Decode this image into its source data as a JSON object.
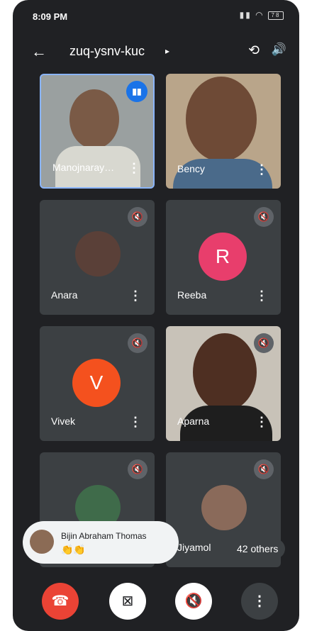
{
  "status_bar": {
    "time": "8:09 PM",
    "battery": "78"
  },
  "header": {
    "meeting_code": "zuq-ysnv-kuc",
    "caret": "▸",
    "back_icon": "←",
    "camera_switch_icon": "⟲",
    "speaker_icon": "🔊"
  },
  "tiles": [
    {
      "name": "Manojnaray…",
      "type": "video",
      "speaking": true
    },
    {
      "name": "Bency",
      "type": "video"
    },
    {
      "name": "Anara",
      "type": "photo",
      "muted": true
    },
    {
      "name": "Reeba",
      "type": "letter",
      "letter": "R",
      "color": "#e83e6c",
      "muted": true
    },
    {
      "name": "Vivek",
      "type": "letter",
      "letter": "V",
      "color": "#f4511e",
      "muted": true
    },
    {
      "name": "Aparna",
      "type": "video",
      "muted": true
    },
    {
      "name": "",
      "type": "photo",
      "muted": true
    },
    {
      "name": "Jiyamol",
      "type": "photo",
      "muted": true
    }
  ],
  "menu_glyph": "⋮",
  "mute_glyph": "🔇",
  "speaking_glyph": "▮▮",
  "toast": {
    "name": "Bijin Abraham Thomas",
    "reaction": "👏👏"
  },
  "others_label": "42 others",
  "controls": {
    "end_call": "☎",
    "video_off": "⊠",
    "mic_off": "🔇",
    "more": "⋮"
  }
}
